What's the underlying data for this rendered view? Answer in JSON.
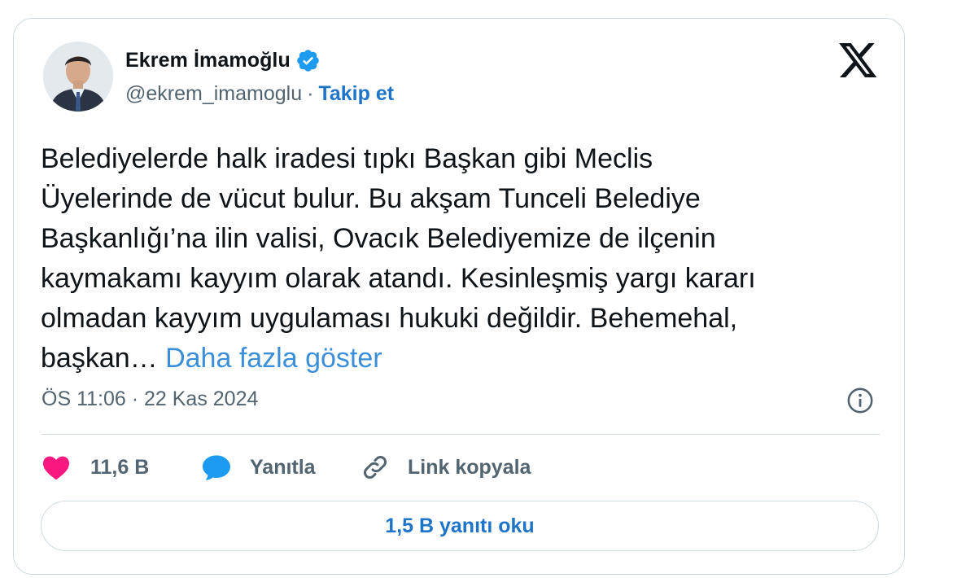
{
  "author": {
    "display_name": "Ekrem İmamoğlu",
    "handle": "@ekrem_imamoglu",
    "separator": "·",
    "follow_label": "Takip et",
    "verified_color": "#1d9bf0"
  },
  "tweet": {
    "text": "Belediyelerde halk iradesi tıpkı Başkan gibi Meclis\nÜyelerinde de vücut bulur. Bu akşam Tunceli Belediye\nBaşkanlığı’na ilin valisi, Ovacık Belediyemize de ilçenin\nkaymakamı kayyım olarak atandı. Kesinleşmiş yargı kararı\nolmadan kayyım uygulaması hukuki değildir. Behemehal,\nbaşkan… ",
    "show_more_label": "Daha fazla göster",
    "timestamp": "ÖS 11:06 · 22 Kas 2024"
  },
  "actions": {
    "like_count": "11,6 B",
    "reply_label": "Yanıtla",
    "copy_link_label": "Link kopyala"
  },
  "read_replies_label": "1,5 B yanıtı oku",
  "icons": {
    "logo": "x-logo-icon",
    "verified": "verified-badge-icon",
    "info": "info-icon",
    "like": "heart-icon",
    "reply": "speech-bubble-icon",
    "copy": "link-icon"
  },
  "colors": {
    "accent": "#1d74c9",
    "link": "#3a8fd8",
    "like": "#f91880",
    "reply": "#1d9bf0",
    "muted": "#536471",
    "border": "#cfd9de"
  }
}
